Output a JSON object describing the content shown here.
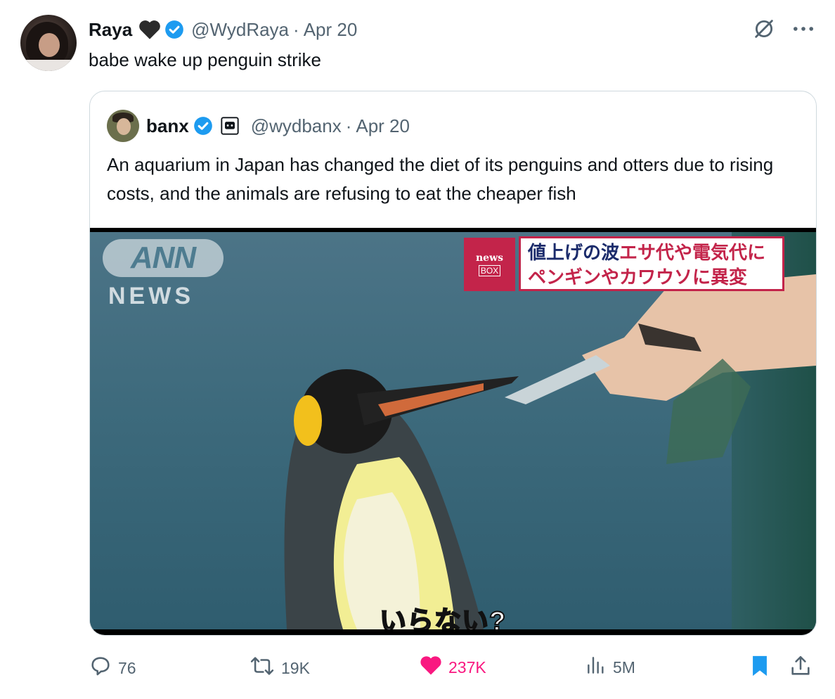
{
  "tweet": {
    "author_name": "Raya",
    "author_handle": "@WydRaya",
    "separator": "·",
    "date": "Apr 20",
    "text": "babe wake up penguin strike"
  },
  "quoted_tweet": {
    "author_name": "banx",
    "author_handle": "@wydbanx",
    "separator": "·",
    "date": "Apr 20",
    "text": "An aquarium in Japan has changed the diet of its penguins and otters due to rising costs, and the animals are refusing to eat the cheaper fish",
    "media": {
      "watermark_top": "ANN",
      "watermark_bottom": "NEWS",
      "newsbox_line1": "news",
      "newsbox_line2": "BOX",
      "caption_line1_a": "値上げの波",
      "caption_line1_b": "エサ代や電気代に",
      "caption_line2": "ペンギンやカワウソに異変",
      "subtitle": "いらない?"
    }
  },
  "actions": {
    "replies": "76",
    "reposts": "19K",
    "likes": "237K",
    "views": "5M"
  },
  "colors": {
    "verified": "#1d9bf0",
    "like": "#f91880",
    "muted_text": "#536471",
    "bookmark": "#1d9bf0"
  },
  "icons": [
    "heart-icon",
    "verified-badge-icon",
    "grok-icon",
    "more-icon",
    "robot-label-icon",
    "reply-icon",
    "repost-icon",
    "like-icon",
    "views-icon",
    "bookmark-icon",
    "share-icon"
  ]
}
